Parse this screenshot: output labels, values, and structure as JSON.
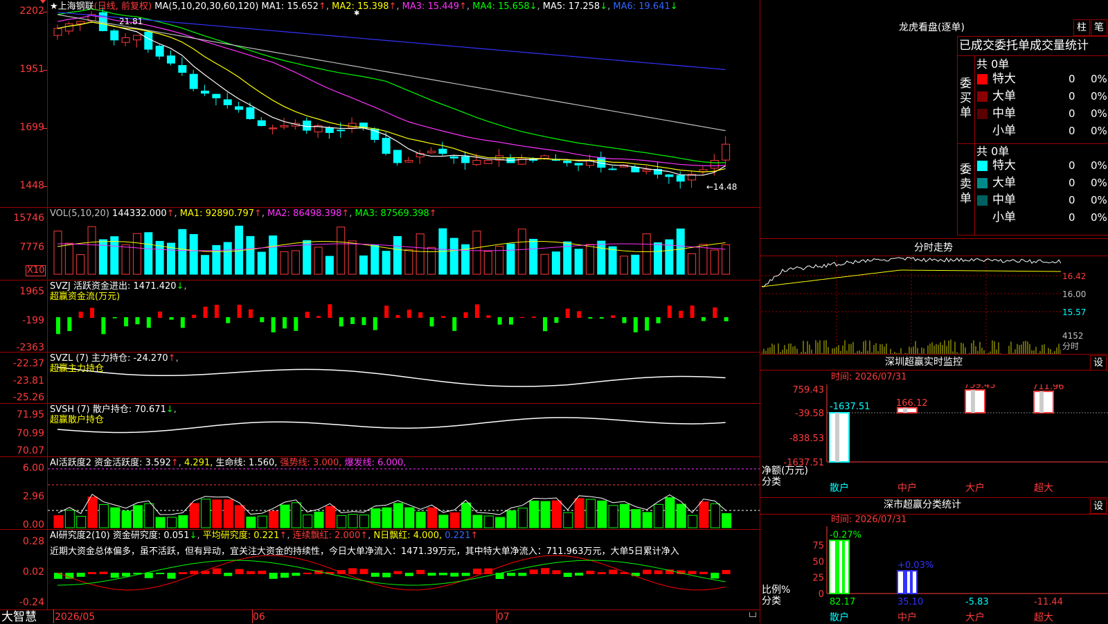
{
  "k": {
    "header": {
      "name": "上海钢联",
      "mode": "(日线, 前复权)",
      "ma_params": "MA(5,10,20,30,60,120)",
      "ma1": "MA1: 15.652",
      "ma2": "MA2: 15.398",
      "ma3": "MA3: 15.449",
      "ma4": "MA4: 15.658",
      "ma5": "MA5: 17.258",
      "ma6": "MA6: 19.641",
      "up": "↑",
      "down": "↓",
      "star": "★",
      "asterisk": "✱"
    },
    "y": [
      "2202",
      "1951",
      "1699",
      "1448"
    ],
    "hi_label": "21.81",
    "lo_label": "←14.48",
    "colors": {
      "ma1": "#ffffff",
      "ma2": "#ffff00",
      "ma3": "#ff33ff",
      "ma4": "#00ff00",
      "ma5": "#c0c0c0",
      "ma6": "#3333ff"
    }
  },
  "vol": {
    "header": "VOL(5,10,20)",
    "val": "144332.000",
    "ma1": "MA1: 92890.797",
    "ma2": "MA2: 86498.398",
    "ma3": "MA3: 87569.398",
    "y": [
      "15746",
      "7776"
    ],
    "unit": "X10"
  },
  "svzj": {
    "header": "SVZJ  活跃资金进出: 1471.420",
    "sub": "超赢资金流(万元)",
    "y": [
      "1965",
      "-199",
      "-2363"
    ]
  },
  "svzl": {
    "header": "SVZL (7) 主力持仓: -24.270",
    "sub": "超赢主力持仓",
    "y": [
      "-22.37",
      "-23.81",
      "-25.26"
    ]
  },
  "svsh": {
    "header": "SVSH (7) 散户持仓: 70.671",
    "sub": "超赢散户持仓",
    "y": [
      "71.95",
      "70.99",
      "70.07"
    ]
  },
  "ai1": {
    "header": "AI活跃度2 资金活跃度: 3.592",
    "v2": "4.291,",
    "life": "生命线: 1.560,",
    "strong": "强势线: 3.000,",
    "burst": "爆发线: 6.000,",
    "y": [
      "6.00",
      "2.96",
      "0.00"
    ]
  },
  "ai2": {
    "header": "AI研究度2(10) 资金研究度: 0.051",
    "avg": "平均研究度: 0.221",
    "cont": "连续飘红: 2.000",
    "nday": "N日飘红: 4.000,",
    "nval": "0.221",
    "text": "近期大资金总体偏多，虽不活跃，但有异动，宜关注大资金的持续性，今日大单净流入：1471.39万元，其中特大单净流入：711.963万元，大单5日累计净入",
    "y": [
      "0.28",
      "0.02",
      "-0.24"
    ]
  },
  "xaxis": {
    "logo": "大智慧",
    "d1": "2026/05",
    "d2": "06",
    "d3": "07"
  },
  "right": {
    "lhb_title": "龙虎看盘(逐单)",
    "btn_zhu": "柱",
    "btn_bi": "笔",
    "stats_title": "已成交委托单成交量统计",
    "buy_label": "委买单",
    "sell_label": "委卖单",
    "buy_total": "共 0单",
    "sell_total": "共 0单",
    "buy_rows": [
      {
        "label": "特大",
        "n": "0",
        "p": "0%",
        "color": "#ff0000"
      },
      {
        "label": "大单",
        "n": "0",
        "p": "0%",
        "color": "#8b0000"
      },
      {
        "label": "中单",
        "n": "0",
        "p": "0%",
        "color": "#5a0000"
      },
      {
        "label": "小单",
        "n": "0",
        "p": "0%",
        "color": "#000000"
      }
    ],
    "sell_rows": [
      {
        "label": "特大",
        "n": "0",
        "p": "0%",
        "color": "#00ffff"
      },
      {
        "label": "大单",
        "n": "0",
        "p": "0%",
        "color": "#008b8b"
      },
      {
        "label": "中单",
        "n": "0",
        "p": "0%",
        "color": "#006060"
      },
      {
        "label": "小单",
        "n": "0",
        "p": "0%",
        "color": "#000000"
      }
    ],
    "fs_title": "分时走势",
    "fs_y": [
      "16.42",
      "16.00",
      "15.57"
    ],
    "fs_vol": "4152",
    "fs_vol_unit": "分时",
    "sz_title": "深圳超赢实时监控",
    "btn_set": "设",
    "sz_time": "时间: 2026/07/31",
    "sz_y": [
      "759.43",
      "-39.58",
      "-838.53",
      "-1637.51"
    ],
    "sz_vals": [
      "-1637.51",
      "166.12",
      "759.43",
      "711.96"
    ],
    "sz_cats": [
      "散户",
      "中户",
      "大户",
      "超大"
    ],
    "sz_ylabel": "净额(万元)",
    "sz_xlabel": "分类",
    "ss_title": "深市超赢分类统计",
    "ss_time": "时间: 2026/07/31",
    "ss_y": [
      "75",
      "50",
      "25",
      "0"
    ],
    "ss_pcts": [
      "-0.27%",
      "+0.03%"
    ],
    "ss_vals": [
      "82.17",
      "35.10",
      "-5.83",
      "-11.44"
    ],
    "ss_cats": [
      "散户",
      "中户",
      "大户",
      "超大"
    ],
    "ss_ylabel": "比例%",
    "ss_xlabel": "分类"
  }
}
